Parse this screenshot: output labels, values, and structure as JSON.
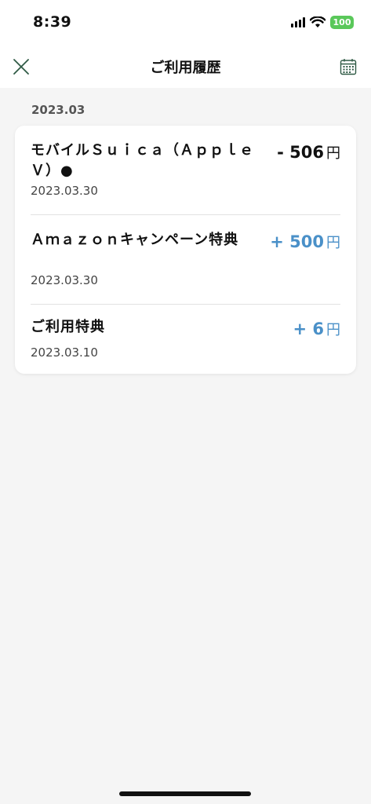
{
  "status_bar": {
    "time": "8:39",
    "battery": "100"
  },
  "nav": {
    "title": "ご利用履歴",
    "close_icon": "close-icon",
    "calendar_icon": "calendar-icon"
  },
  "history": {
    "month": "2023.03",
    "items": [
      {
        "title": "モバイルＳｕｉｃａ（ＡｐｐｌｅＶ）●",
        "date": "2023.03.30",
        "amount": "- 506",
        "unit": "円",
        "sign": "negative"
      },
      {
        "title": "Ａｍａｚｏｎキャンペーン特典",
        "date": "2023.03.30",
        "amount": "+ 500",
        "unit": "円",
        "sign": "positive"
      },
      {
        "title": "ご利用特典",
        "date": "2023.03.10",
        "amount": "+ 6",
        "unit": "円",
        "sign": "positive"
      }
    ]
  },
  "colors": {
    "positive": "#4a90c8",
    "negative": "#111111",
    "battery": "#5ac85a"
  }
}
